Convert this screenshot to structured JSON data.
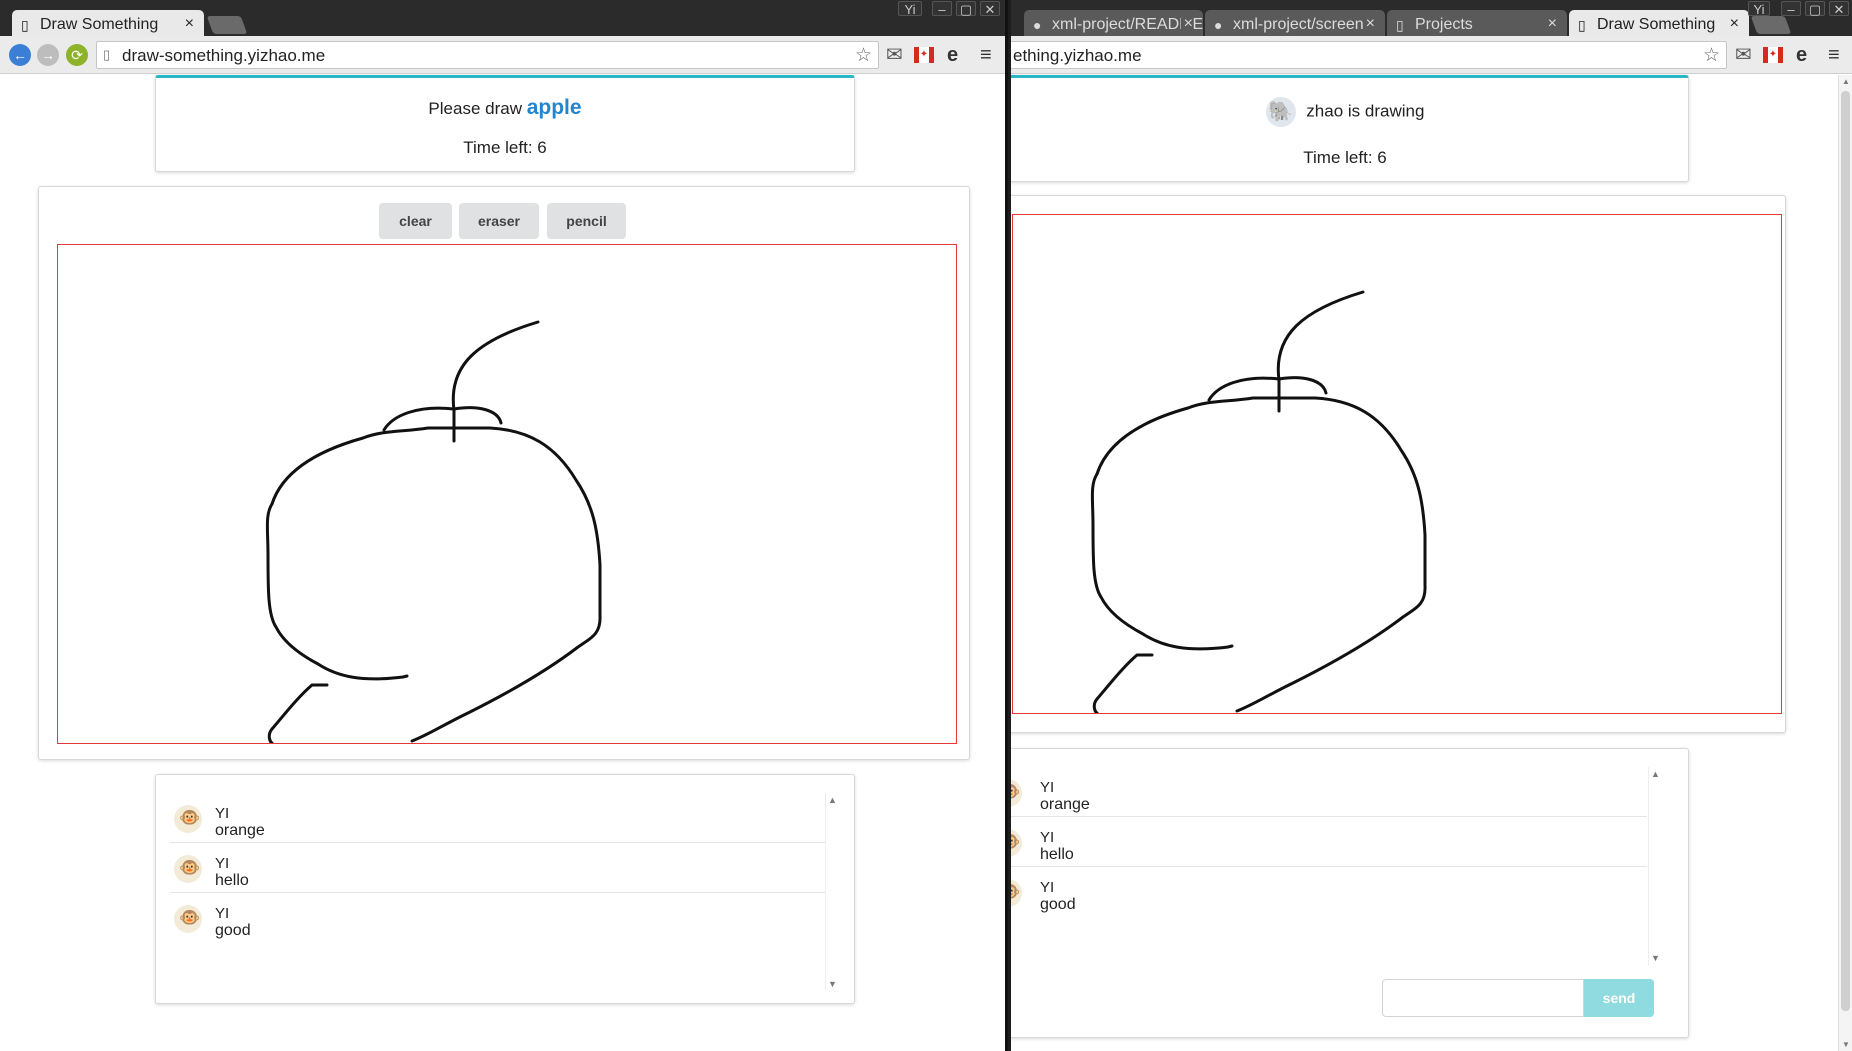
{
  "left_window": {
    "user_badge": "Yi",
    "tabs": [
      {
        "title": "Draw Something",
        "active": true
      }
    ],
    "url": "draw-something.yizhao.me",
    "prompt_prefix": "Please draw",
    "prompt_word": "apple",
    "time_left": "Time left: 6",
    "tools": {
      "clear": "clear",
      "eraser": "eraser",
      "pencil": "pencil"
    },
    "messages": [
      {
        "name": "YI",
        "text": "orange"
      },
      {
        "name": "YI",
        "text": "hello"
      },
      {
        "name": "YI",
        "text": "good"
      }
    ]
  },
  "right_window": {
    "user_badge": "Yi",
    "tabs": [
      {
        "title": "xml-project/README",
        "icon": "github-icon"
      },
      {
        "title": "xml-project/screen",
        "icon": "github-icon"
      },
      {
        "title": "Projects",
        "icon": "page-icon"
      },
      {
        "title": "Draw Something",
        "icon": "page-icon",
        "active": true
      }
    ],
    "url": "ething.yizhao.me",
    "drawing_status": "zhao is drawing",
    "time_left": "Time left: 6",
    "messages": [
      {
        "name": "YI",
        "text": "orange"
      },
      {
        "name": "YI",
        "text": "hello"
      },
      {
        "name": "YI",
        "text": "good"
      }
    ],
    "chat_input_placeholder": "",
    "send_label": "send"
  },
  "colors": {
    "accent_teal": "#29b7c7",
    "word_blue": "#2185d0",
    "canvas_border": "#e53935",
    "send_button": "#8fdbe0"
  }
}
